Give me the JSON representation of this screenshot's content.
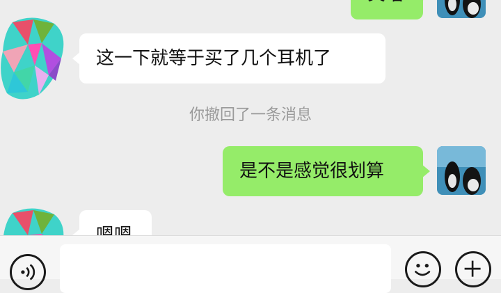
{
  "messages": [
    {
      "id": "m0",
      "side": "out",
      "text": "笑嘻"
    },
    {
      "id": "m1",
      "side": "in",
      "text": "这一下就等于买了几个耳机了"
    },
    {
      "id": "m2",
      "side": "system",
      "text": "你撤回了一条消息"
    },
    {
      "id": "m3",
      "side": "out",
      "text": "是不是感觉很划算"
    },
    {
      "id": "m4",
      "side": "in",
      "text": "嗯嗯"
    }
  ],
  "input": {
    "value": "",
    "placeholder": ""
  },
  "icons": {
    "voice": "voice-icon",
    "emoji": "emoji-icon",
    "more": "plus-icon"
  },
  "colors": {
    "chat_background": "#ededed",
    "outgoing_bubble": "#95ec69",
    "incoming_bubble": "#ffffff",
    "system_text": "#999999"
  }
}
